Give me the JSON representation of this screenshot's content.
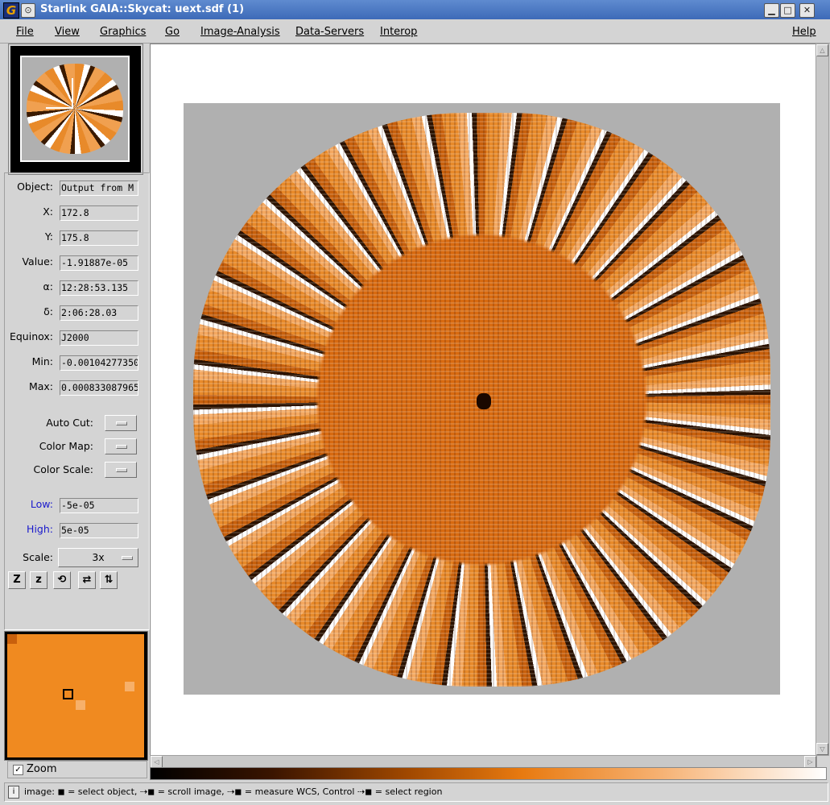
{
  "window": {
    "title": "Starlink GAIA::Skycat: uext.sdf (1)",
    "app_icon": "G",
    "menu_icon": "⊙",
    "minimize": "▁",
    "maximize": "□",
    "close": "✕"
  },
  "menubar": {
    "items": [
      "File",
      "View",
      "Graphics",
      "Go",
      "Image-Analysis",
      "Data-Servers",
      "Interop"
    ],
    "help": "Help"
  },
  "info": {
    "object": {
      "label": "Object:",
      "value": "Output from M"
    },
    "x": {
      "label": "X:",
      "value": "172.8"
    },
    "y": {
      "label": "Y:",
      "value": "175.8"
    },
    "value": {
      "label": "Value:",
      "value": "-1.91887e-05"
    },
    "alpha": {
      "label": "α:",
      "value": "12:28:53.135"
    },
    "delta": {
      "label": "δ:",
      "value": "2:06:28.03"
    },
    "equinox": {
      "label": "Equinox:",
      "value": "J2000"
    },
    "min": {
      "label": "Min:",
      "value": "-0.00104277350"
    },
    "max": {
      "label": "Max:",
      "value": "0.000833087965"
    }
  },
  "options": {
    "auto_cut": "Auto Cut:",
    "color_map": "Color Map:",
    "color_scale": "Color Scale:"
  },
  "levels": {
    "low_label": "Low:",
    "low_value": "-5e-05",
    "high_label": "High:",
    "high_value": "5e-05"
  },
  "scale": {
    "label": "Scale:",
    "value": "3x"
  },
  "tools": [
    "Z",
    "z",
    "⟲",
    "⇄",
    "⇅"
  ],
  "zoom": {
    "label": "Zoom",
    "checked": "✓"
  },
  "scroll": {
    "up": "△",
    "down": "▽",
    "left": "◁",
    "right": "▷"
  },
  "status": {
    "icon": "i",
    "text": "image: ◼ = select object, ⇢◼ = scroll image, ⇢◼ = measure WCS, Control ⇢◼ = select region"
  },
  "colors": {
    "accent_low_high": "#1a1acc",
    "image_orange": "#e88a2a",
    "titlebar": "#3d6ab8"
  }
}
